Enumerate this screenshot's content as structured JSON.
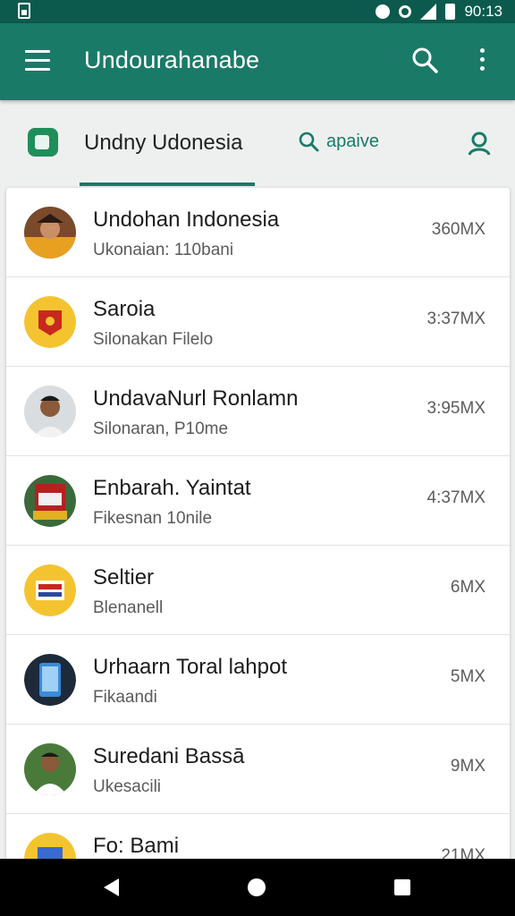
{
  "status_bar": {
    "time": "90:13"
  },
  "app_bar": {
    "title": "Undourahanabe"
  },
  "tabs": {
    "main_label": "Undny Udonesia",
    "search_label": "apaive"
  },
  "list": [
    {
      "title": "Undohan Indonesia",
      "subtitle": "Ukonaian: 110bani",
      "meta": "360MX"
    },
    {
      "title": "Saroia",
      "subtitle": "Silonakan Filelo",
      "meta": "3:37MX"
    },
    {
      "title": "UndavaNurl Ronlamn",
      "subtitle": "Silonaran, P10me",
      "meta": "3:95MX"
    },
    {
      "title": "Enbarah. Yaintat",
      "subtitle": "Fikesnan 10nile",
      "meta": "4:37MX"
    },
    {
      "title": "Seltier",
      "subtitle": "Blenanell",
      "meta": "6MX"
    },
    {
      "title": "Urhaarn Toral lahpot",
      "subtitle": "Fikaandi",
      "meta": "5MX"
    },
    {
      "title": "Suredani Bassā",
      "subtitle": "Ukesacili",
      "meta": "9MX"
    },
    {
      "title": "Fo: Bami",
      "subtitle": "",
      "meta": "21MX"
    }
  ],
  "colors": {
    "primary": "#1a7a68",
    "status_bar": "#0c5a4d"
  }
}
